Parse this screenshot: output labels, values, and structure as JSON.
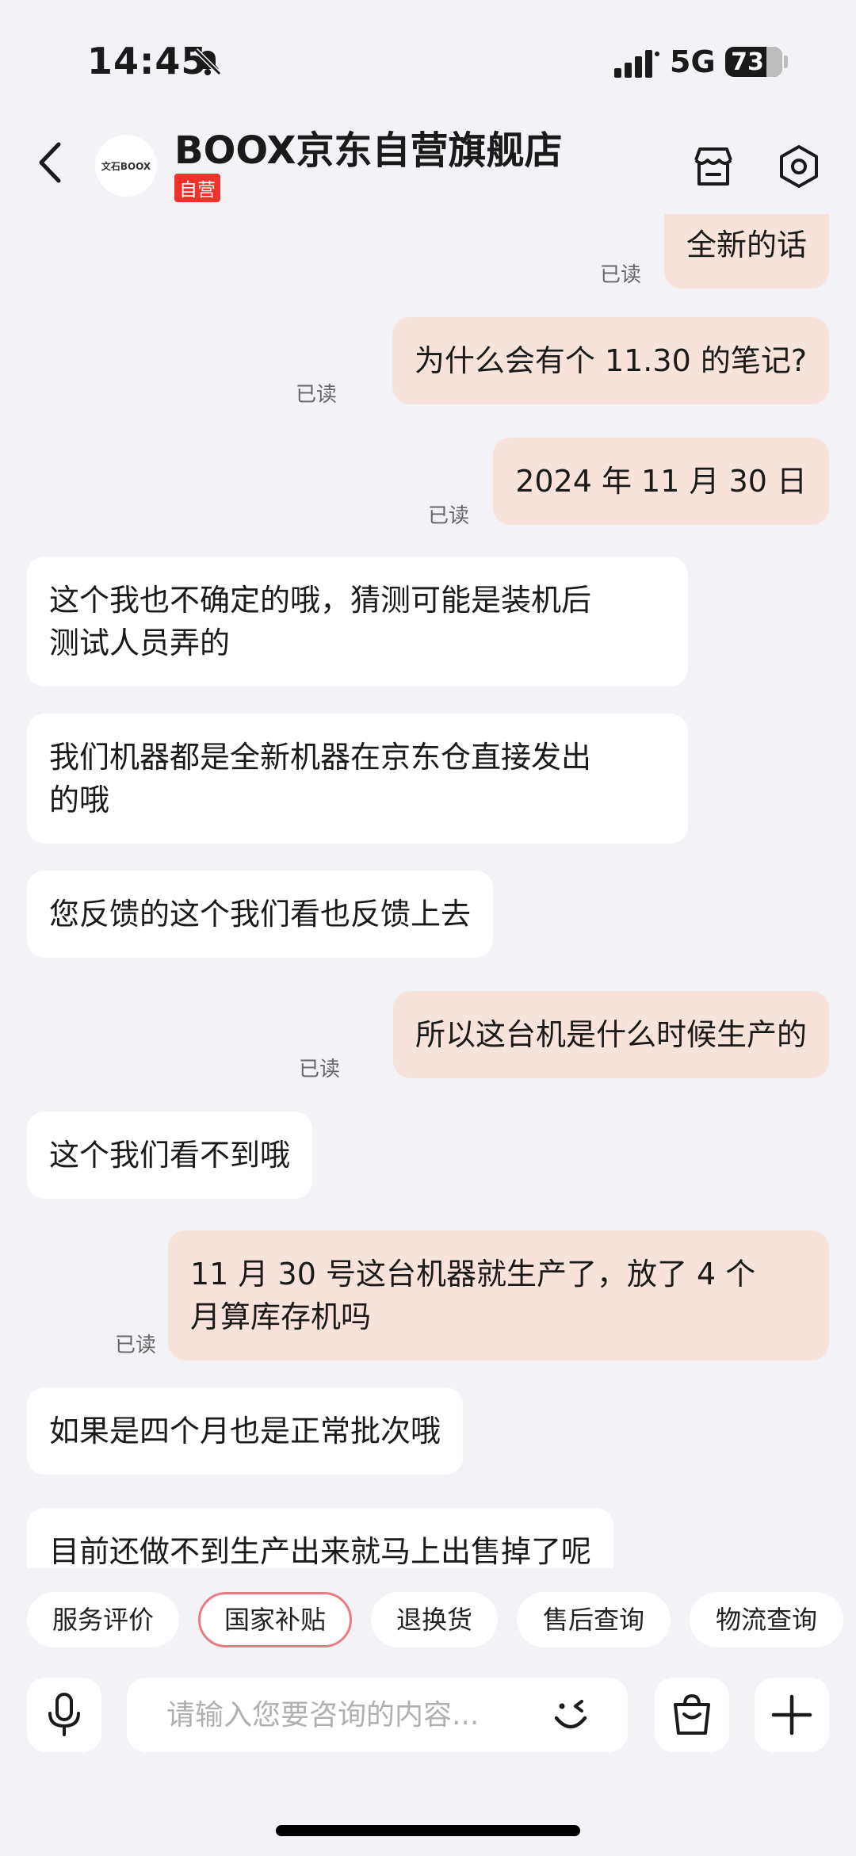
{
  "status": {
    "time": "14:45",
    "network": "5G",
    "battery": "73"
  },
  "header": {
    "store_name": "BOOX京东自营旗舰店",
    "badge": "自营",
    "avatar_text": "文石BOOX"
  },
  "messages": [
    {
      "side": "out",
      "text": "全新的话",
      "status": "已读"
    },
    {
      "side": "out",
      "text": "为什么会有个 11.30 的笔记?",
      "status": "已读"
    },
    {
      "side": "out",
      "text": "2024 年 11 月 30 日",
      "status": "已读"
    },
    {
      "side": "in",
      "lines": [
        "这个我也不确定的哦，猜测可能是装机后",
        "测试人员弄的"
      ]
    },
    {
      "side": "in",
      "lines": [
        "我们机器都是全新机器在京东仓直接发出",
        "的哦"
      ]
    },
    {
      "side": "in",
      "text": "您反馈的这个我们看也反馈上去"
    },
    {
      "side": "out",
      "text": "所以这台机是什么时候生产的",
      "status": "已读"
    },
    {
      "side": "in",
      "text": "这个我们看不到哦"
    },
    {
      "side": "out",
      "lines": [
        "11 月 30 号这台机器就生产了，放了 4 个",
        "月算库存机吗"
      ],
      "status": "已读"
    },
    {
      "side": "in",
      "text": "如果是四个月也是正常批次哦"
    },
    {
      "side": "in",
      "text": "目前还做不到生产出来就马上出售掉了呢"
    }
  ],
  "quick_actions": [
    "服务评价",
    "国家补贴",
    "退换货",
    "售后查询",
    "物流查询"
  ],
  "input": {
    "placeholder": "请输入您要咨询的内容..."
  },
  "icons": {
    "back": "chevron-left-icon",
    "shop": "shop-icon",
    "settings": "settings-icon",
    "mic": "microphone-icon",
    "emoji": "wink-emoji-icon",
    "bag": "shopping-bag-icon",
    "plus": "plus-icon"
  },
  "colors": {
    "outgoing_bubble": "#f8e2dc",
    "incoming_bubble": "#ffffff",
    "badge": "#f0322a",
    "highlight_chip_border": "#e87b86"
  }
}
